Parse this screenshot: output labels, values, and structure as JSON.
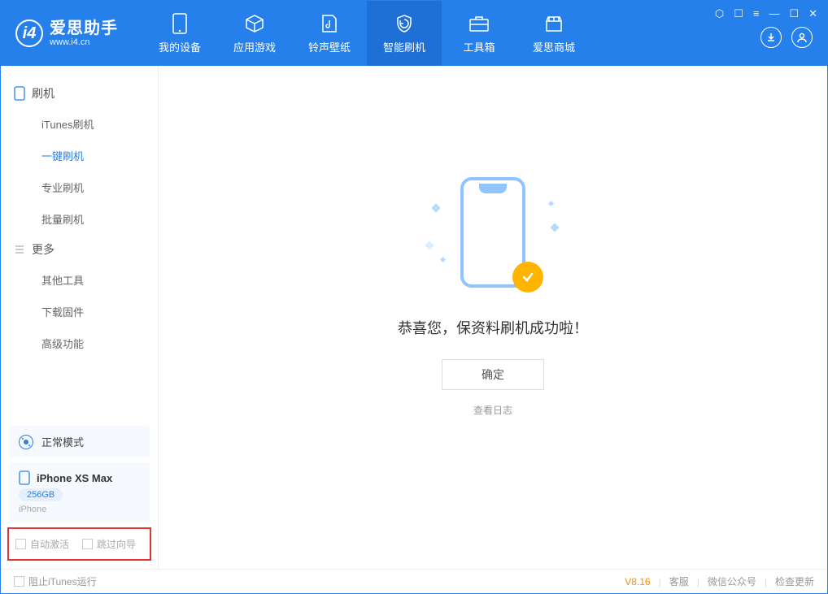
{
  "app": {
    "title": "爱思助手",
    "url": "www.i4.cn"
  },
  "tabs": {
    "device": "我的设备",
    "apps": "应用游戏",
    "ring": "铃声壁纸",
    "flash": "智能刷机",
    "toolbox": "工具箱",
    "store": "爱思商城"
  },
  "sidebar": {
    "group1": "刷机",
    "items1": {
      "itunes": "iTunes刷机",
      "oneclick": "一键刷机",
      "pro": "专业刷机",
      "batch": "批量刷机"
    },
    "group2": "更多",
    "items2": {
      "other": "其他工具",
      "firmware": "下载固件",
      "adv": "高级功能"
    },
    "mode": "正常模式",
    "device": {
      "name": "iPhone XS Max",
      "storage": "256GB",
      "type": "iPhone"
    },
    "cb1": "自动激活",
    "cb2": "跳过向导"
  },
  "main": {
    "success": "恭喜您，保资料刷机成功啦！",
    "ok": "确定",
    "log": "查看日志"
  },
  "footer": {
    "block_itunes": "阻止iTunes运行",
    "version": "V8.16",
    "kf": "客服",
    "wx": "微信公众号",
    "update": "检查更新"
  }
}
